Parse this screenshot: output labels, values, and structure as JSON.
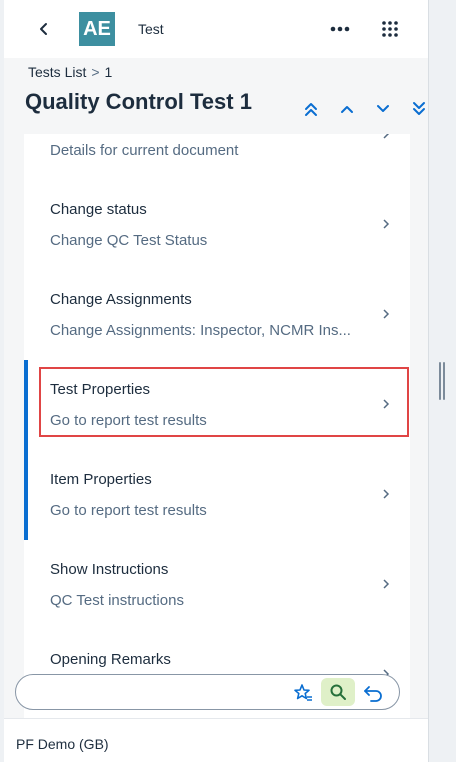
{
  "shell": {
    "logo_text": "AE",
    "app_title": "Test"
  },
  "header": {
    "breadcrumb": {
      "link": "Tests List",
      "separator": ">",
      "current": "1"
    },
    "title": "Quality Control Test 1"
  },
  "list": {
    "items": [
      {
        "title": "",
        "description": "Details for current document",
        "flagged": false
      },
      {
        "title": "Change status",
        "description": "Change QC Test Status",
        "flagged": false
      },
      {
        "title": "Change Assignments",
        "description": "Change Assignments: Inspector, NCMR Ins...",
        "flagged": false
      },
      {
        "title": "Test Properties",
        "description": "Go to report test results",
        "flagged": true
      },
      {
        "title": "Item Properties",
        "description": "Go to report test results",
        "flagged": true
      },
      {
        "title": "Show Instructions",
        "description": "QC Test instructions",
        "flagged": false
      },
      {
        "title": "Opening Remarks",
        "description": "",
        "flagged": false
      }
    ]
  },
  "footer": {
    "environment": "PF Demo (GB)"
  },
  "colors": {
    "accent": "#0a6ed1",
    "logo_bg": "#3d8fa0",
    "highlight_border": "#e04545",
    "search_active_bg": "#dff0c8"
  },
  "icons": [
    "back-arrow-icon",
    "more-dots-icon",
    "app-grid-icon",
    "double-up-icon",
    "up-icon",
    "down-icon",
    "double-down-icon",
    "chevron-right-icon",
    "star-list-icon",
    "search-icon",
    "undo-icon"
  ]
}
